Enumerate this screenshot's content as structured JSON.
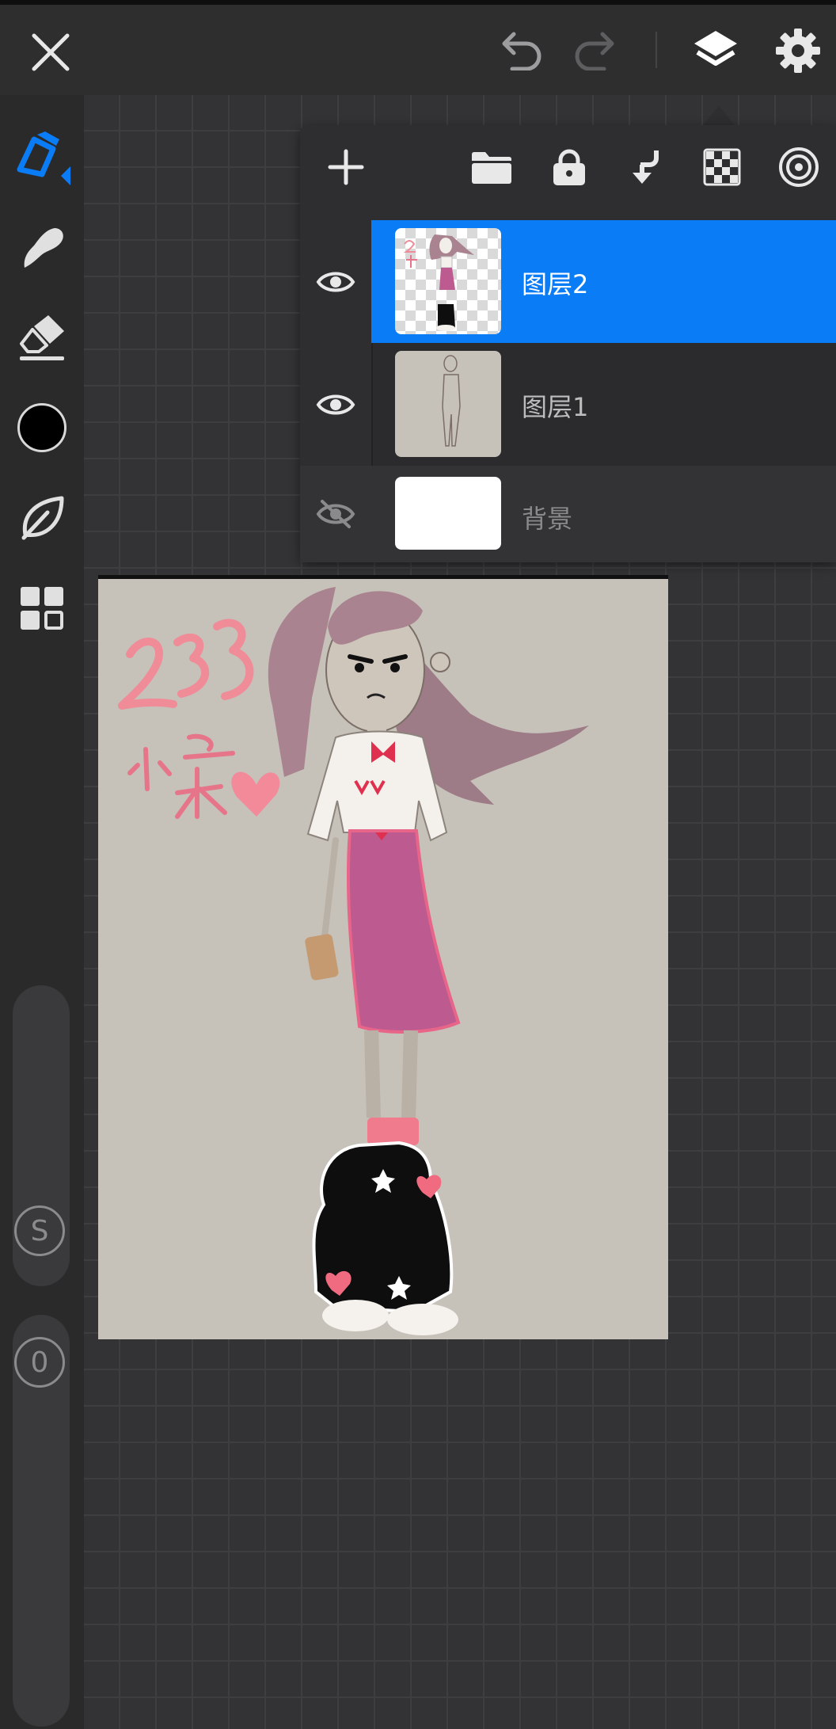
{
  "app": {
    "accent_color": "#0a7cf5",
    "current_color": "#000000"
  },
  "toolbar": {
    "close_icon": "close-icon",
    "undo_icon": "undo-icon",
    "redo_icon": "redo-icon",
    "layers_icon": "layers-icon",
    "settings_icon": "gear-icon"
  },
  "tools": [
    {
      "name": "brush",
      "icon": "pen-icon",
      "selected": true
    },
    {
      "name": "smudge",
      "icon": "smudge-icon",
      "selected": false
    },
    {
      "name": "eraser",
      "icon": "eraser-icon",
      "selected": false
    },
    {
      "name": "color",
      "icon": "color-swatch",
      "selected": false
    },
    {
      "name": "brush-library",
      "icon": "leaf-icon",
      "selected": false
    },
    {
      "name": "gallery",
      "icon": "grid-icon",
      "selected": false
    }
  ],
  "sliders": {
    "size_label": "S",
    "opacity_label": "0"
  },
  "layers_panel": {
    "actions": [
      "add-layer",
      "folder",
      "lock",
      "merge-down",
      "alpha-lock",
      "clipping"
    ],
    "layers": [
      {
        "name": "图层2",
        "visible": true,
        "selected": true
      },
      {
        "name": "图层1",
        "visible": true,
        "selected": false
      },
      {
        "name": "背景",
        "visible": false,
        "selected": false
      }
    ]
  },
  "artwork": {
    "text": "233 小柒"
  }
}
